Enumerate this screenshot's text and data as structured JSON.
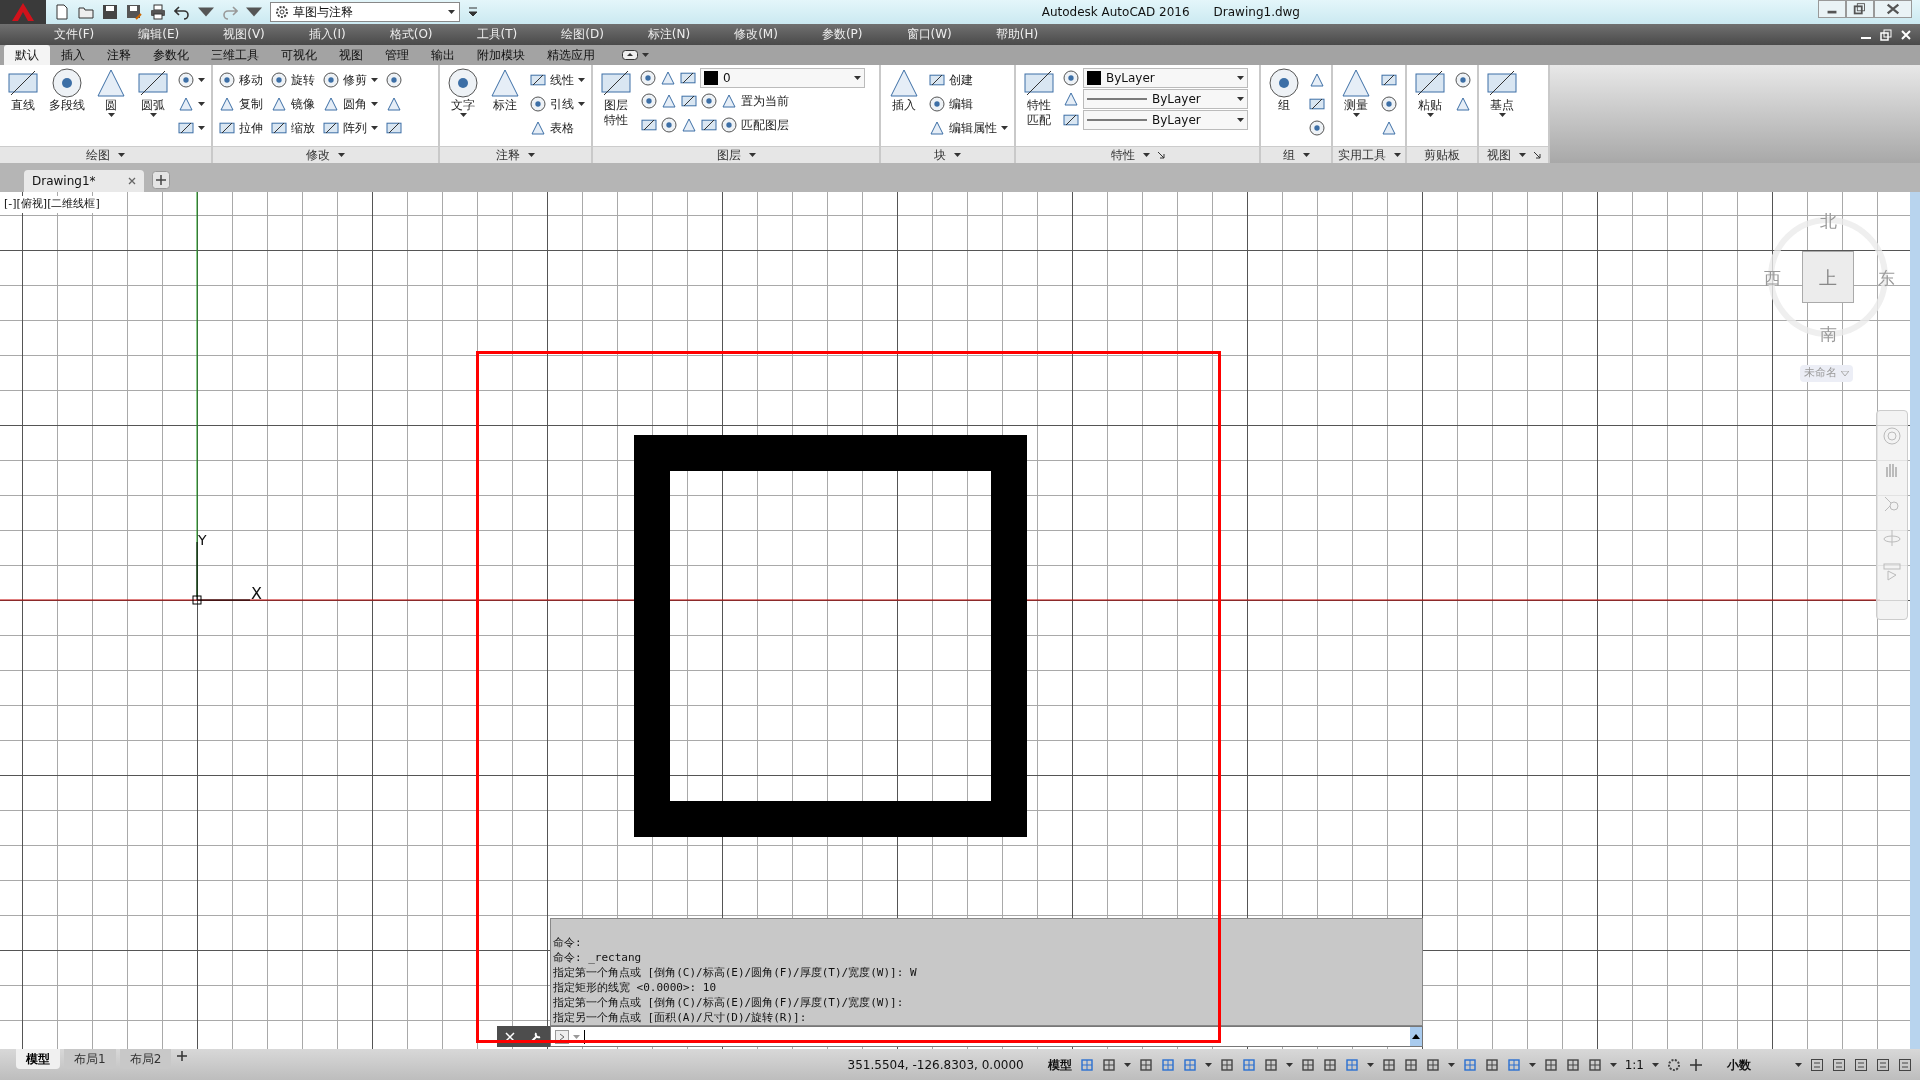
{
  "title_bar": {
    "workspace": "草图与注释",
    "app_title": "Autodesk AutoCAD 2016",
    "document": "Drawing1.dwg"
  },
  "menu": [
    "文件(F)",
    "编辑(E)",
    "视图(V)",
    "插入(I)",
    "格式(O)",
    "工具(T)",
    "绘图(D)",
    "标注(N)",
    "修改(M)",
    "参数(P)",
    "窗口(W)",
    "帮助(H)"
  ],
  "ribbon_tabs": [
    {
      "label": "默认",
      "selected": true
    },
    {
      "label": "插入",
      "selected": false
    },
    {
      "label": "注释",
      "selected": false
    },
    {
      "label": "参数化",
      "selected": false
    },
    {
      "label": "三维工具",
      "selected": false
    },
    {
      "label": "可视化",
      "selected": false
    },
    {
      "label": "视图",
      "selected": false
    },
    {
      "label": "管理",
      "selected": false
    },
    {
      "label": "输出",
      "selected": false
    },
    {
      "label": "附加模块",
      "selected": false
    },
    {
      "label": "精选应用",
      "selected": false
    }
  ],
  "ribbon_panels": [
    {
      "title": "绘图",
      "menu": true,
      "columns": [
        {
          "kind": "large",
          "label": "直线",
          "dropdown": false
        },
        {
          "kind": "large",
          "label": "多段线",
          "dropdown": false
        },
        {
          "kind": "large",
          "label": "圆",
          "dropdown": true
        },
        {
          "kind": "large",
          "label": "圆弧",
          "dropdown": true
        },
        {
          "kind": "stack",
          "items": [
            {
              "dropdown": true
            },
            {
              "dropdown": true
            },
            {
              "dropdown": true
            }
          ]
        }
      ]
    },
    {
      "title": "修改",
      "menu": true,
      "columns": [
        {
          "kind": "stack",
          "items": [
            {
              "label": "移动",
              "dropdown": false
            },
            {
              "label": "复制",
              "dropdown": false
            },
            {
              "label": "拉伸",
              "dropdown": false
            }
          ]
        },
        {
          "kind": "stack",
          "items": [
            {
              "label": "旋转",
              "dropdown": false
            },
            {
              "label": "镜像",
              "dropdown": false
            },
            {
              "label": "缩放",
              "dropdown": false
            }
          ]
        },
        {
          "kind": "stack",
          "items": [
            {
              "label": "修剪",
              "dropdown": true
            },
            {
              "label": "圆角",
              "dropdown": true
            },
            {
              "label": "阵列",
              "dropdown": true
            }
          ]
        },
        {
          "kind": "stack",
          "items": [
            {
              "dropdown": false
            },
            {
              "dropdown": false
            },
            {
              "dropdown": false
            }
          ]
        }
      ]
    },
    {
      "title": "注释",
      "menu": true,
      "columns": [
        {
          "kind": "large",
          "label": "文字",
          "dropdown": true
        },
        {
          "kind": "large",
          "label": "标注",
          "dropdown": false
        },
        {
          "kind": "stack",
          "items": [
            {
              "label": "线性",
              "dropdown": true
            },
            {
              "label": "引线",
              "dropdown": true
            },
            {
              "label": "表格",
              "dropdown": false
            }
          ]
        }
      ]
    },
    {
      "title": "图层",
      "menu": true,
      "columns": [
        {
          "kind": "large",
          "label": "图层特性",
          "dropdown": false
        },
        {
          "kind": "stack",
          "items": [
            {
              "kind": "layer",
              "value": "0"
            },
            {
              "kind": "multi",
              "label": "置为当前",
              "dropdown": false
            },
            {
              "kind": "multi",
              "label": "匹配图层",
              "dropdown": false
            }
          ]
        }
      ]
    },
    {
      "title": "块",
      "menu": true,
      "columns": [
        {
          "kind": "large",
          "label": "插入",
          "dropdown": false
        },
        {
          "kind": "stack",
          "items": [
            {
              "label": "创建",
              "dropdown": false
            },
            {
              "label": "编辑",
              "dropdown": false
            },
            {
              "label": "编辑属性",
              "dropdown": true
            }
          ]
        }
      ]
    },
    {
      "title": "特性",
      "menu": true,
      "launcher": true,
      "columns": [
        {
          "kind": "large",
          "label": "特性匹配",
          "dropdown": false
        },
        {
          "kind": "stack",
          "items": [
            {
              "kind": "color",
              "value": "ByLayer"
            },
            {
              "kind": "line",
              "value": "ByLayer"
            },
            {
              "kind": "line",
              "value": "ByLayer"
            }
          ]
        }
      ]
    },
    {
      "title": "组",
      "menu": true,
      "columns": [
        {
          "kind": "large",
          "label": "组",
          "dropdown": false
        },
        {
          "kind": "stack",
          "items": [
            {
              "dropdown": false
            },
            {
              "dropdown": false
            },
            {
              "dropdown": false
            }
          ]
        }
      ]
    },
    {
      "title": "实用工具",
      "menu": true,
      "columns": [
        {
          "kind": "large",
          "label": "测量",
          "dropdown": true
        },
        {
          "kind": "stack",
          "items": [
            {
              "dropdown": false
            },
            {
              "dropdown": false
            },
            {
              "dropdown": false
            }
          ]
        }
      ]
    },
    {
      "title": "剪贴板",
      "menu": false,
      "columns": [
        {
          "kind": "large",
          "label": "粘贴",
          "dropdown": true
        },
        {
          "kind": "stack",
          "items": [
            {
              "dropdown": false
            },
            {
              "dropdown": false
            }
          ]
        }
      ]
    },
    {
      "title": "视图",
      "menu": true,
      "launcher": true,
      "columns": [
        {
          "kind": "large",
          "label": "基点",
          "dropdown": true
        }
      ]
    }
  ],
  "document_tabs": [
    {
      "label": "Drawing1*",
      "selected": true
    }
  ],
  "viewport_label": "[-][俯视][二维线框]",
  "ucs": {
    "x_label": "X",
    "y_label": "Y"
  },
  "viewcube": {
    "north": "北",
    "west": "西",
    "east": "东",
    "south": "南",
    "face": "上",
    "ucs_menu": "未命名"
  },
  "command_history": [
    "命令:",
    "命令: _rectang",
    "指定第一个角点或 [倒角(C)/标高(E)/圆角(F)/厚度(T)/宽度(W)]: W",
    "指定矩形的线宽 <0.0000>: 10",
    "指定第一个角点或 [倒角(C)/标高(E)/圆角(F)/厚度(T)/宽度(W)]:",
    "指定另一个角点或 [面积(A)/尺寸(D)/旋转(R)]:"
  ],
  "layout_tabs": [
    {
      "label": "模型",
      "selected": true
    },
    {
      "label": "布局1",
      "selected": false
    },
    {
      "label": "布局2",
      "selected": false
    }
  ],
  "status_bar": {
    "coordinates": "351.5504, -126.8303, 0.0000",
    "space": "模型",
    "scale": "1:1",
    "units": "小数"
  }
}
